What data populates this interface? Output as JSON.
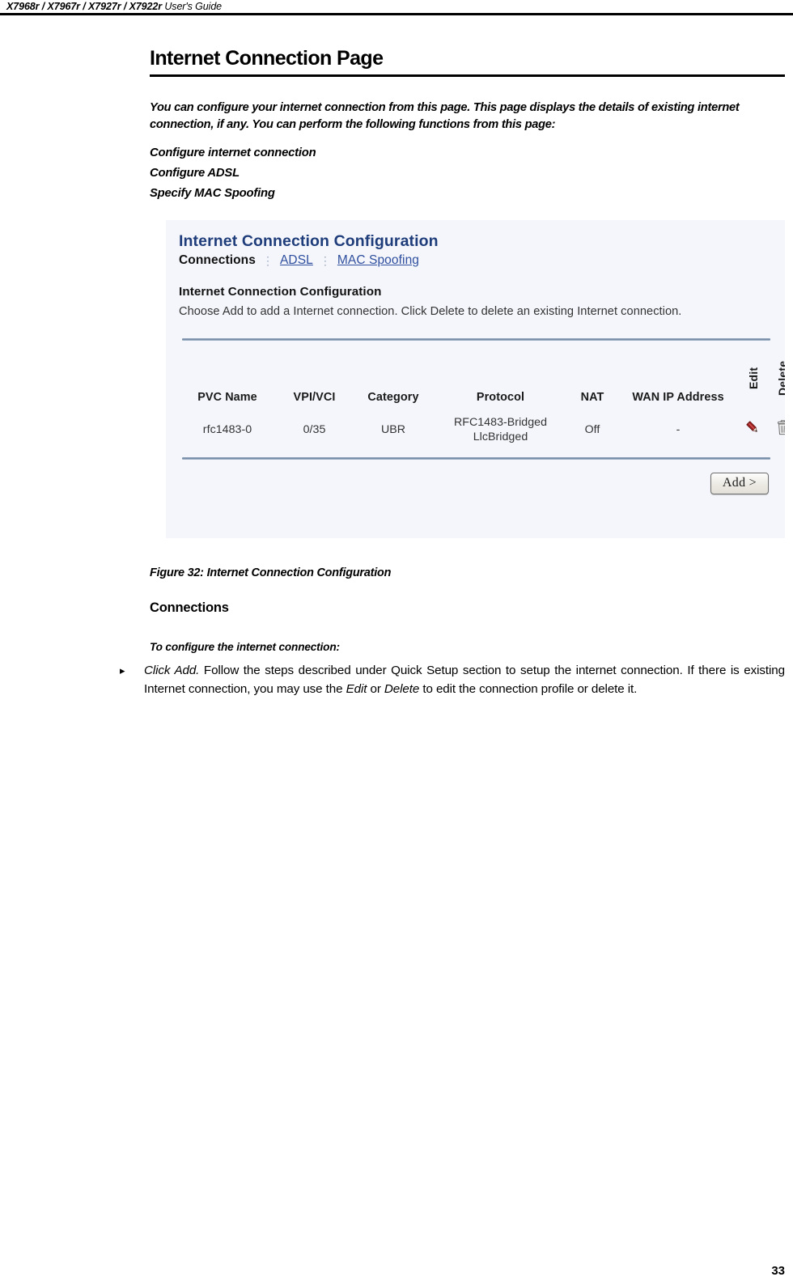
{
  "header": {
    "models": "X7968r / X7967r / X7927r / X7922r",
    "guide_label": "User's Guide"
  },
  "page_title": "Internet Connection Page",
  "intro_paragraph": "You can configure your internet connection from this page. This page displays the details of existing internet connection, if any. You can perform the following functions from this page:",
  "functions": [
    "Configure internet connection",
    "Configure ADSL",
    "Specify MAC Spoofing"
  ],
  "figure": {
    "title": "Internet Connection Configuration",
    "title_color": "#1f3d7a",
    "background_color": "#f4f6fb",
    "rule_color": "#6d84a0",
    "tabs": {
      "active": "Connections",
      "separator": "⋮",
      "links": [
        "ADSL",
        "MAC Spoofing"
      ],
      "link_color": "#2f4f9e"
    },
    "section_title": "Internet Connection Configuration",
    "description": "Choose Add to add a Internet connection. Click Delete to delete an existing Internet connection.",
    "table": {
      "columns": [
        "PVC Name",
        "VPI/VCI",
        "Category",
        "Protocol",
        "NAT",
        "WAN IP Address",
        "Edit",
        "Delete"
      ],
      "rows": [
        {
          "pvc_name": "rfc1483-0",
          "vpi_vci": "0/35",
          "category": "UBR",
          "protocol_line1": "RFC1483-Bridged",
          "protocol_line2": "LlcBridged",
          "nat": "Off",
          "wan_ip_address": "-",
          "edit_icon": "pencil-icon",
          "edit_icon_color": "#8c1b1b",
          "delete_icon": "trash-icon",
          "delete_icon_color": "#7c7c7c"
        }
      ]
    },
    "add_button_label": "Add >"
  },
  "figure_caption": "Figure 32: Internet Connection Configuration",
  "sub_heading": "Connections",
  "lead_in": "To configure the internet connection:",
  "bullet": {
    "marker": "▸",
    "segments": [
      {
        "text": "Click Add.",
        "italic": true
      },
      {
        "text": " Follow the steps described under Quick Setup  section to setup the internet connection. If there is existing Internet connection, you may use the ",
        "italic": false
      },
      {
        "text": "Edit",
        "italic": true
      },
      {
        "text": " or ",
        "italic": false
      },
      {
        "text": "Delete",
        "italic": true
      },
      {
        "text": " to edit the connection profile or delete it.",
        "italic": false
      }
    ]
  },
  "page_number": "33"
}
